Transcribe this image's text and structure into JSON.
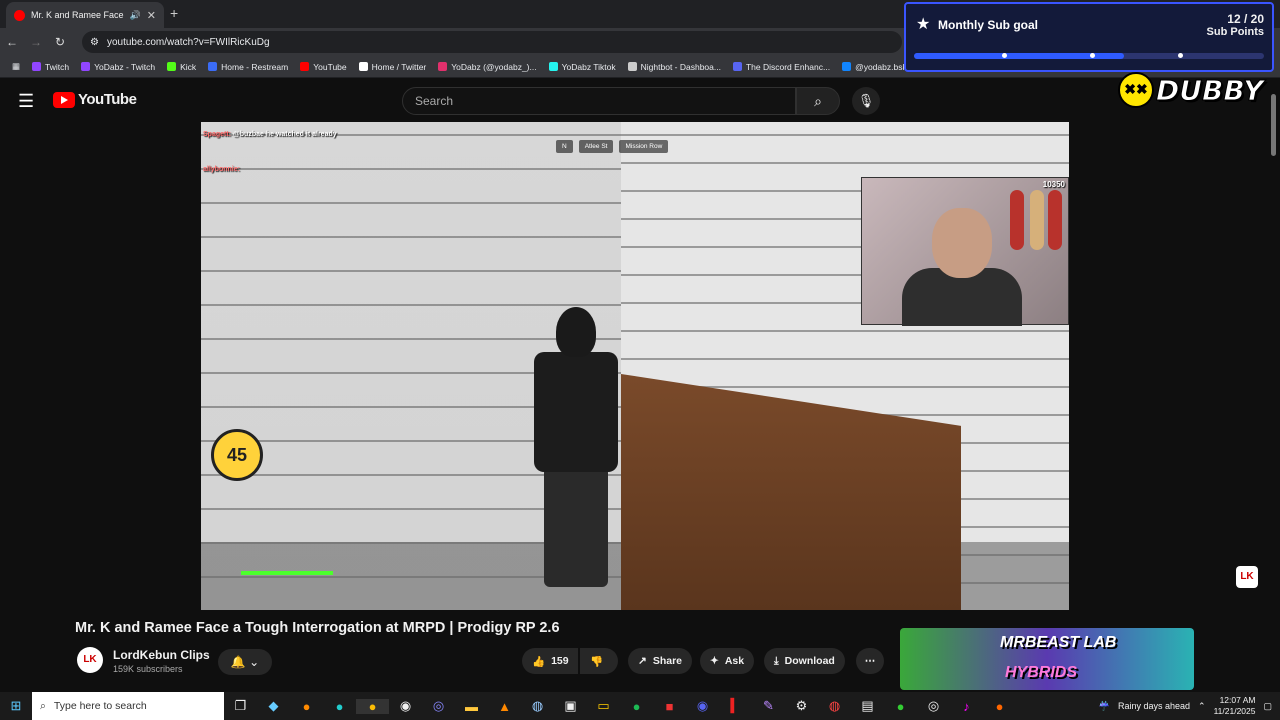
{
  "browser": {
    "tab_title": "Mr. K and Ramee Face a To",
    "url": "youtube.com/watch?v=FWIlRicKuDg",
    "bookmarks": [
      {
        "label": "Twitch",
        "color": "#9146ff"
      },
      {
        "label": "YoDabz - Twitch",
        "color": "#9146ff"
      },
      {
        "label": "Kick",
        "color": "#53fc18"
      },
      {
        "label": "Home - Restream",
        "color": "#3b6cf6"
      },
      {
        "label": "YouTube",
        "color": "#ff0000"
      },
      {
        "label": "Home / Twitter",
        "color": "#ffffff"
      },
      {
        "label": "YoDabz (@yodabz_)...",
        "color": "#e1306c"
      },
      {
        "label": "YoDabz Tiktok",
        "color": "#25f4ee"
      },
      {
        "label": "Nightbot - Dashboa...",
        "color": "#cccccc"
      },
      {
        "label": "The Discord Enhanc...",
        "color": "#5865f2"
      },
      {
        "label": "@yodabz.bsky.socia...",
        "color": "#1185fe"
      }
    ]
  },
  "sub_goal": {
    "label": "Monthly Sub goal",
    "count": "12 / 20",
    "unit": "Sub Points",
    "progress": 0.6
  },
  "youtube": {
    "logo_text": "YouTube",
    "search_placeholder": "Search"
  },
  "overlay": {
    "brand": "DUBBY",
    "chat": [
      {
        "user": "Spagett:",
        "text": "@buzbae he watched it already"
      },
      {
        "user": "allybonnie:",
        "text": ""
      }
    ],
    "hud_chips": [
      "N",
      "Atlee St",
      "Mission Row"
    ],
    "level_badge": "45",
    "viewers": "10350"
  },
  "video": {
    "title": "Mr. K and Ramee Face a Tough Interrogation at MRPD | Prodigy RP 2.6",
    "channel": "LordKebun Clips",
    "subscribers": "159K subscribers",
    "likes": "159",
    "actions": {
      "share": "Share",
      "ask": "Ask",
      "download": "Download"
    }
  },
  "ad": {
    "line1": "MRBEAST LAB",
    "line2": "HYBRIDS"
  },
  "taskbar": {
    "search_placeholder": "Type here to search",
    "weather": "Rainy days ahead",
    "time": "12:07 AM",
    "date": "11/21/2025"
  }
}
